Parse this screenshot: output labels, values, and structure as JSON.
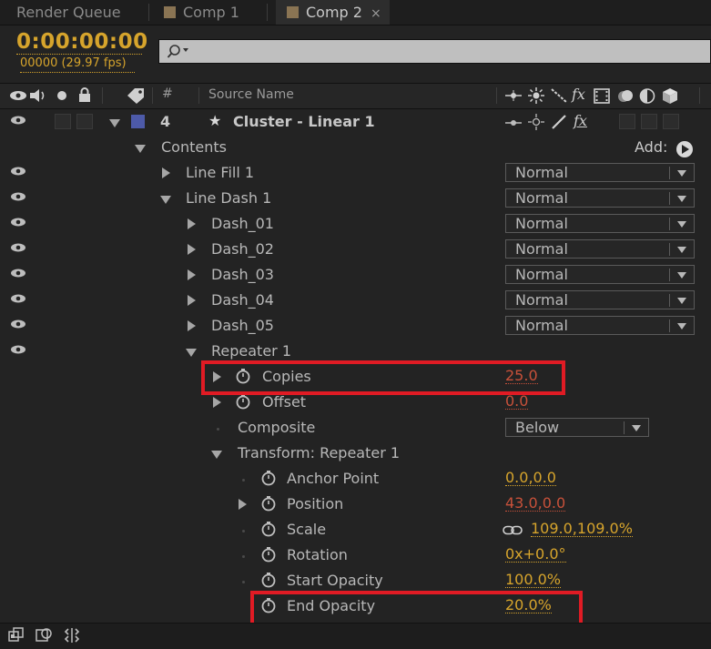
{
  "tabs": [
    {
      "label": "Render Queue"
    },
    {
      "label": "Comp 1"
    },
    {
      "label": "Comp 2",
      "close": "×"
    }
  ],
  "header": {
    "timecode": "0:00:00:00",
    "framecode": "00000 (29.97 fps)",
    "search": {
      "value": "",
      "placeholder": ""
    }
  },
  "columns": {
    "number": "#",
    "source_name": "Source Name"
  },
  "layer": {
    "number": "4",
    "name": "Cluster - Linear 1",
    "label_color": "#4d5aa8"
  },
  "tree": {
    "contents": "Contents",
    "add_label": "Add:",
    "line_fill": "Line Fill 1",
    "line_dash": "Line Dash 1",
    "dashes": [
      "Dash_01",
      "Dash_02",
      "Dash_03",
      "Dash_04",
      "Dash_05"
    ],
    "blend_mode": "Normal",
    "repeater": "Repeater 1",
    "copies": {
      "label": "Copies",
      "value": "25.0"
    },
    "offset": {
      "label": "Offset",
      "value": "0.0"
    },
    "composite": {
      "label": "Composite",
      "value": "Below"
    },
    "transform": "Transform: Repeater 1",
    "anchor_point": {
      "label": "Anchor Point",
      "value": "0.0,0.0"
    },
    "position": {
      "label": "Position",
      "value": "43.0,0.0"
    },
    "scale": {
      "label": "Scale",
      "value": "109.0,109.0%"
    },
    "rotation": {
      "label": "Rotation",
      "value": "0x+0.0°"
    },
    "start_opacity": {
      "label": "Start Opacity",
      "value": "100.0%"
    },
    "end_opacity": {
      "label": "End Opacity",
      "value": "20.0%"
    }
  },
  "colors": {
    "accent_value": "#d6a42c",
    "keyed_value": "#c8513a",
    "highlight_box": "#e01b24"
  }
}
